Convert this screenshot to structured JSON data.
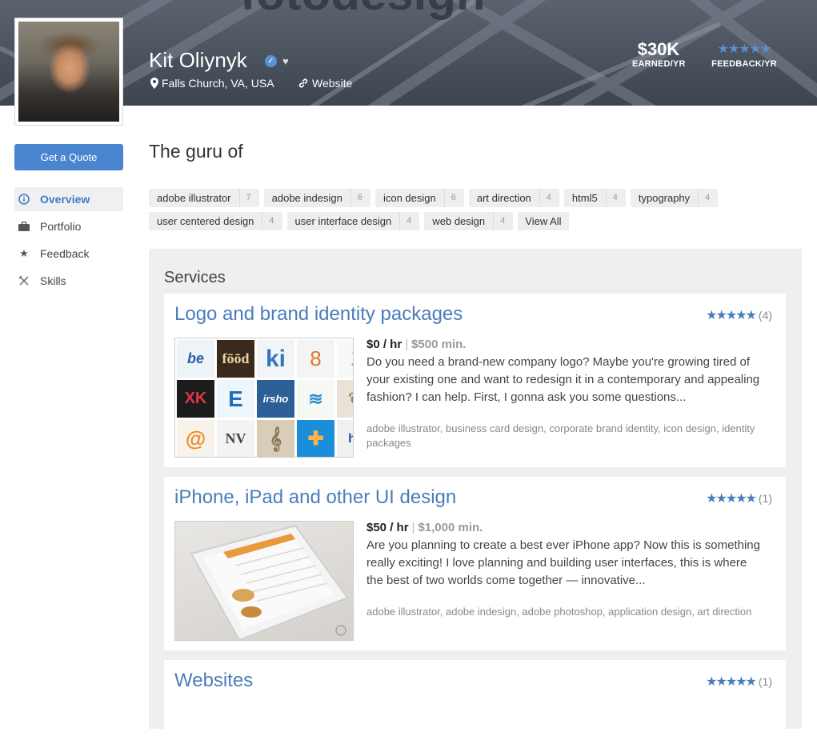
{
  "profile": {
    "name": "Kit Oliynyk",
    "location": "Falls Church, VA, USA",
    "website_label": "Website",
    "earned_value": "$30K",
    "earned_label": "EARNED/YR",
    "feedback_stars": "★★★★★",
    "feedback_label": "FEEDBACK/YR"
  },
  "sidebar": {
    "quote_button": "Get a Quote",
    "items": [
      {
        "label": "Overview",
        "icon": "info-icon",
        "active": true
      },
      {
        "label": "Portfolio",
        "icon": "briefcase-icon"
      },
      {
        "label": "Feedback",
        "icon": "star-icon"
      },
      {
        "label": "Skills",
        "icon": "tools-icon"
      }
    ]
  },
  "main": {
    "guru_title": "The guru of",
    "tags": [
      {
        "label": "adobe illustrator",
        "count": "7"
      },
      {
        "label": "adobe indesign",
        "count": "6"
      },
      {
        "label": "icon design",
        "count": "6"
      },
      {
        "label": "art direction",
        "count": "4"
      },
      {
        "label": "html5",
        "count": "4"
      },
      {
        "label": "typography",
        "count": "4"
      },
      {
        "label": "user centered design",
        "count": "4"
      },
      {
        "label": "user interface design",
        "count": "4"
      },
      {
        "label": "web design",
        "count": "4"
      }
    ],
    "view_all": "View All",
    "services_title": "Services",
    "services": [
      {
        "title": "Logo and brand identity packages",
        "stars": "★★★★★",
        "count": "(4)",
        "rate": "$0 / hr",
        "sep": "|",
        "min": "$500 min.",
        "description": "Do you need a brand-new company logo? Maybe you're growing tired of your existing one and want to redesign it in a contemporary and appealing fashion? I can help. First, I gonna ask you some questions...",
        "skills": "adobe illustrator,  business card design,  corporate brand identity,  icon design,  identity packages"
      },
      {
        "title": "iPhone, iPad and other UI design",
        "stars": "★★★★★",
        "count": "(1)",
        "rate": "$50 / hr",
        "sep": "|",
        "min": "$1,000 min.",
        "description": "Are you planning to create a best ever iPhone app? Now this is something really exciting! I love planning and building user interfaces, this is where the best of two worlds come together — innovative...",
        "skills": "adobe illustrator,  adobe indesign,  adobe photoshop,  application design,  art direction"
      },
      {
        "title": "Websites",
        "stars": "★★★★★",
        "count": "(1)"
      }
    ]
  },
  "colors": {
    "accent": "#4a86cf",
    "link": "#4a7dba",
    "banner": "#4a525e"
  }
}
